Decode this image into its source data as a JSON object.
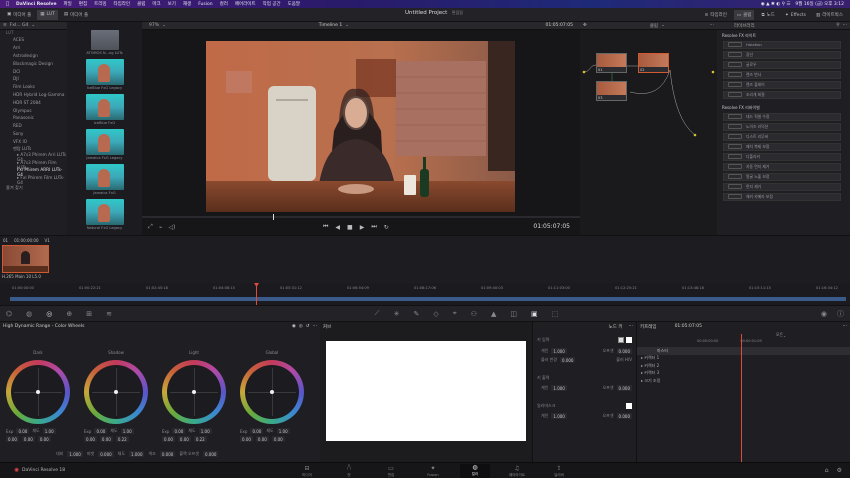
{
  "macbar": {
    "app": "DaVinci Resolve",
    "menus": [
      "파일",
      "편집",
      "트리밍",
      "타임라인",
      "클립",
      "마크",
      "보기",
      "재생",
      "Fusion",
      "컬러",
      "페어라이트",
      "작업 공간",
      "도움말"
    ],
    "clock": "9월 16일 (금) 오후 3:12"
  },
  "appbar": {
    "left_buttons": [
      "미디어 풀",
      "LUT",
      "미디어 풀"
    ],
    "title": "Untitled Project",
    "subtitle": "편집됨",
    "right_buttons": [
      "타임라인",
      "클립",
      "노드",
      "Effects",
      "라이트박스"
    ],
    "zoom": "97%",
    "timeline": "Timeline 1",
    "timecode": "01:05:07:05",
    "node_mode": "클립"
  },
  "library": {
    "header": "Fxl... G4",
    "section": "LUT",
    "items": [
      "ACES",
      "Arri",
      "Astrodesign",
      "Blackmagic Design",
      "DCI",
      "DJI",
      "Film Looks",
      "HDR Hybrid Log-Gamma",
      "HDR ST 2084",
      "Olympus",
      "Panasonic",
      "RED",
      "Sony",
      "VFX IO",
      "팬탐 LUTs",
      "▸ A7s3 Phirem Arri LUTs G4",
      "▸ A7s3 Phirem Film LUTs -",
      "Fxl Phirem ARRI LUTs-G4",
      "▸ Fxl Phirem Film LUTs-G4",
      "즐겨 찾기"
    ]
  },
  "thumbs": [
    {
      "caption": "ATOMOS N...ng LUTs"
    },
    {
      "caption": "IceBlue FxG Legacy"
    },
    {
      "caption": "IceBlue FxG"
    },
    {
      "caption": "Jamaica FxG Legacy"
    },
    {
      "caption": "Jamaica FxG"
    },
    {
      "caption": "Natural FxG Legacy"
    }
  ],
  "viewer": {
    "timecode": "01:05:07:05"
  },
  "nodes": [
    {
      "label": "01"
    },
    {
      "label": "02"
    },
    {
      "label": "03"
    }
  ],
  "fx": {
    "section1": "Resolve FX 라이트",
    "items1": [
      "Halation",
      "광선",
      "글로우",
      "렌즈 반사",
      "렌즈 플레어",
      "조리개 회절"
    ],
    "section2": "Resolve FX 리바이벌",
    "items2": [
      "데드 픽셀 수정",
      "노이즈 리덕션",
      "디스트 리무버",
      "패치 복제 보정",
      "디플리커",
      "자동 먼지 제거",
      "얼굴 노출 보정",
      "먼지 제거",
      "체커 카메라 보정"
    ]
  },
  "clips": {
    "num": "01",
    "tc": "01:00:00:00",
    "track": "V1",
    "codec": "H.265 Main 10 L5.0"
  },
  "ruler": {
    "ticks": [
      "01:00:00:00",
      "01:00:22:21",
      "01:02:45:18",
      "01:04:08:15",
      "01:05:31:12",
      "01:06:54:09",
      "01:08:17:06",
      "01:09:40:03",
      "01:11:03:00",
      "01:12:25:21",
      "01:13:48:18",
      "01:15:11:15",
      "01:16:34:12"
    ]
  },
  "wheels": {
    "title": "High Dynamic Range - Color Wheels",
    "items": [
      {
        "name": "Dark",
        "exp": "0.00",
        "sat": "1.00",
        "x": "0.00",
        "y": "0.00",
        "z": "0.00"
      },
      {
        "name": "Shadow",
        "exp": "0.00",
        "sat": "1.00",
        "x": "0.00",
        "y": "0.00",
        "z": "0.22"
      },
      {
        "name": "Light",
        "exp": "0.00",
        "sat": "1.00",
        "x": "0.00",
        "y": "0.00",
        "z": "0.22"
      },
      {
        "name": "Global",
        "exp": "0.00",
        "sat": "1.00",
        "x": "0.00",
        "y": "0.00",
        "z": "0.00"
      }
    ],
    "exp_label": "Exp",
    "sat_label": "채도",
    "bottom": [
      {
        "label": "대비",
        "val": "1.000"
      },
      {
        "label": "피벗",
        "val": "0.000"
      },
      {
        "label": "채도",
        "val": "1.000"
      },
      {
        "label": "색조",
        "val": "0.000"
      },
      {
        "label": "블랙 오프셋",
        "val": "0.000"
      }
    ]
  },
  "curves": {
    "title": "커브"
  },
  "keyer": {
    "title": "노드 키",
    "key_in": "키 입력",
    "gain": "게인",
    "gain_val": "1.000",
    "offset": "오프셋",
    "offset_val": "0.000",
    "blur_radius": "블러 반경",
    "blur_val": "0.000",
    "blur_hv": "블러 H/V",
    "key_out": "키 출력",
    "key_out_gain": "1.000",
    "key_out_off": "0.000",
    "mask": "일리마스크",
    "mask_gain": "1.000",
    "mask_off": "0.000"
  },
  "keyframes": {
    "title": "키프레임",
    "tc": "01:05:07:05",
    "all": "모든",
    "ruler_tc": "00:00:00:00",
    "ruler_tc2": "00:00:01:09",
    "rows": [
      "마스터",
      "▸ 커렉터 1",
      "▸ 커렉터 2",
      "▸ 커렉터 3",
      "▸ 크기 조정"
    ]
  },
  "pagebar": {
    "brand": "DaVinci Resolve 18",
    "pages": [
      "미디어",
      "컷",
      "편집",
      "Fusion",
      "컬러",
      "페어라이트",
      "딜리버"
    ],
    "active": "컬러"
  }
}
